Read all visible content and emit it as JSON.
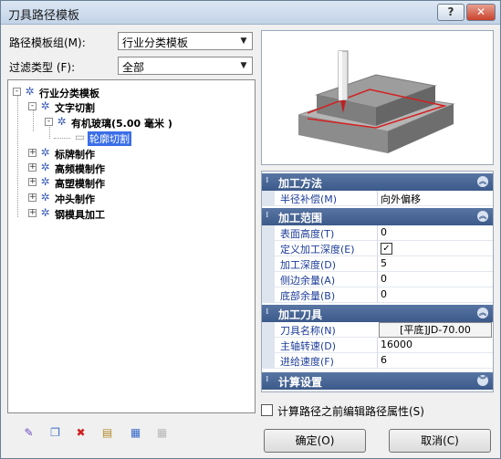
{
  "window": {
    "title": "刀具路径模板",
    "help_label": "?",
    "close_label": "✕"
  },
  "filters": {
    "group_label": "路径模板组(M):",
    "group_value": "行业分类模板",
    "type_label": "过滤类型  (F):",
    "type_value": "全部"
  },
  "tree": {
    "root": "行业分类模板",
    "text_cut": "文字切割",
    "acrylic": "有机玻璃(5.00 毫米 )",
    "contour": "轮廓切割",
    "sign": "标牌制作",
    "hf": "高频模制作",
    "blister": "高塑模制作",
    "punch": "冲头制作",
    "steel": "钢模具加工"
  },
  "props": {
    "method": {
      "title": "加工方法",
      "comp_key": "半径补偿(M)",
      "comp_val": "向外偏移"
    },
    "range": {
      "title": "加工范围",
      "surface_key": "表面高度(T)",
      "surface_val": "0",
      "define_key": "定义加工深度(E)",
      "depth_key": "加工深度(D)",
      "depth_val": "5",
      "side_key": "侧边余量(A)",
      "side_val": "0",
      "bottom_key": "底部余量(B)",
      "bottom_val": "0"
    },
    "tool": {
      "title": "加工刀具",
      "name_key": "刀具名称(N)",
      "name_val": "[平底]JD-70.00",
      "spindle_key": "主轴转速(D)",
      "spindle_val": "16000",
      "feed_key": "进给速度(F)",
      "feed_val": "6"
    },
    "calc": {
      "title": "计算设置"
    }
  },
  "edit_before_calc_label": "计算路径之前编辑路径属性(S)",
  "ok_label": "确定(O)",
  "cancel_label": "取消(C)"
}
